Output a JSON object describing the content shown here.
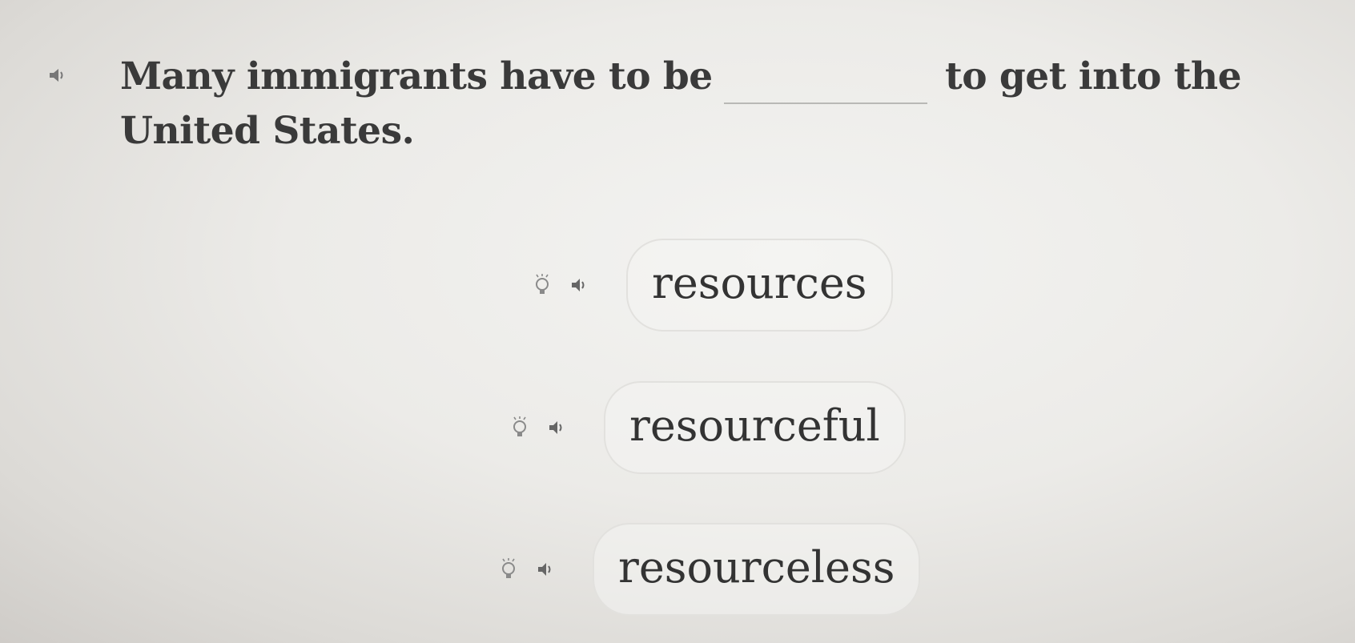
{
  "question": {
    "text_before": "Many immigrants have to be",
    "text_after": "to get into the",
    "text_line2": "United States.",
    "audio_icon": "speaker-icon"
  },
  "options": [
    {
      "label": "resources",
      "hint_icon": "lightbulb-icon",
      "audio_icon": "speaker-icon"
    },
    {
      "label": "resourceful",
      "hint_icon": "lightbulb-icon",
      "audio_icon": "speaker-icon"
    },
    {
      "label": "resourceless",
      "hint_icon": "lightbulb-icon",
      "audio_icon": "speaker-icon"
    }
  ],
  "colors": {
    "text": "#3a3a3a",
    "icon": "#6f6f6f",
    "pill_border": "#e2e1de"
  }
}
